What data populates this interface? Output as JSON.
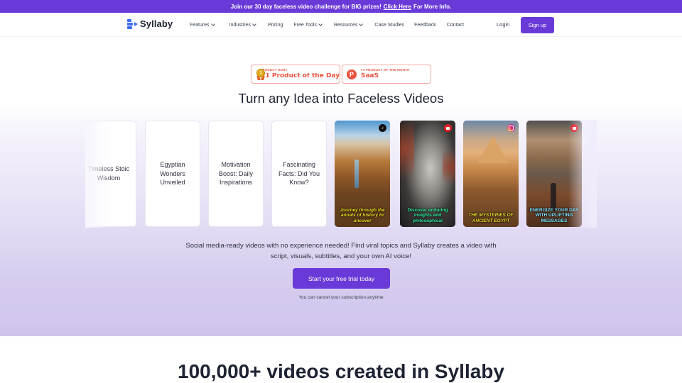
{
  "promo": {
    "text": "Join our 30 day faceless video challenge for BIG prizes!",
    "link_label": "Click Here",
    "suffix": "For More Info."
  },
  "nav": {
    "brand": "Syllaby",
    "links": [
      {
        "label": "Features",
        "dropdown": true
      },
      {
        "label": "Industries",
        "dropdown": true
      },
      {
        "label": "Pricing",
        "dropdown": false
      },
      {
        "label": "Free Tools",
        "dropdown": true
      },
      {
        "label": "Resources",
        "dropdown": true
      },
      {
        "label": "Case Studies",
        "dropdown": false
      },
      {
        "label": "Feedback",
        "dropdown": false
      },
      {
        "label": "Contact",
        "dropdown": false
      }
    ],
    "login_label": "Login",
    "signup_label": "Sign up"
  },
  "badges": [
    {
      "small": "PRODUCT HUNT",
      "big": "#1 Product of the Day",
      "icon": "medal-icon",
      "medal_number": "1"
    },
    {
      "small": "#3 PRODUCT OF THE MONTH",
      "big": "SaaS",
      "icon": "product-hunt-icon",
      "logo_letter": "P"
    }
  ],
  "hero": {
    "title": "Turn any Idea into Faceless Videos",
    "description": "Social media-ready videos with no experience needed! Find viral topics and Syllaby creates a video with script, visuals, subtitles, and your own AI voice!",
    "cta_label": "Start your free trial today",
    "cancel_note": "You can cancel your subscription anytime"
  },
  "carousel": {
    "topics": [
      "Timeless Stoic Wisdom",
      "Egyptian Wonders Unveiled",
      "Motivation Boost: Daily Inspirations",
      "Fascinating Facts: Did You Know?"
    ],
    "videos": [
      {
        "caption": "Journey through the annals of history to uncover",
        "platform": "tiktok",
        "caption_color": "#f2e21a"
      },
      {
        "caption": "Discover enduring insights and philosophical",
        "platform": "youtube",
        "caption_color": "#2ef0a0"
      },
      {
        "caption": "THE MYSTERIES OF ANCIENT EGYPT",
        "platform": "instagram",
        "caption_color": "#f5dd2a"
      },
      {
        "caption": "ENERGIZE YOUR DAY WITH UPLIFTING MESSAGES",
        "platform": "youtube",
        "caption_color": "#7fe3ff"
      }
    ]
  },
  "stats": {
    "title": "100,000+ videos created in Syllaby"
  },
  "colors": {
    "brand_purple": "#6a3ad8",
    "logo_blue": "#3b6df5",
    "badge_red": "#e8523e"
  }
}
